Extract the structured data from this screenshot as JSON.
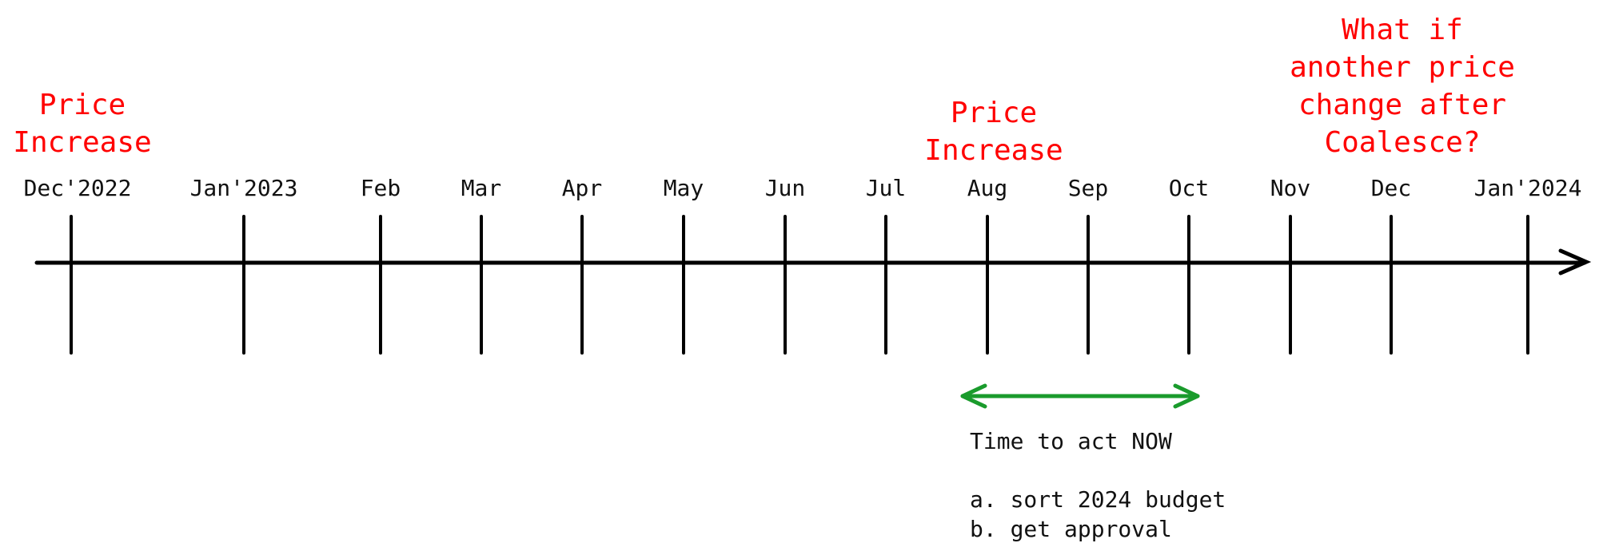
{
  "timeline": {
    "months": [
      "Dec'2022",
      "Jan'2023",
      "Feb",
      "Mar",
      "Apr",
      "May",
      "Jun",
      "Jul",
      "Aug",
      "Sep",
      "Oct",
      "Nov",
      "Dec",
      "Jan'2024"
    ],
    "axis_color": "#000000",
    "direction": "right-arrow"
  },
  "annotations": {
    "price_increase_1": {
      "anchor_month": "Dec'2022",
      "lines": [
        "Price",
        "Increase"
      ],
      "color": "#ff0000"
    },
    "price_increase_2": {
      "anchor_month": "Aug",
      "lines": [
        "Price",
        "Increase"
      ],
      "color": "#ff0000"
    },
    "what_if": {
      "anchor_month": "Dec",
      "lines": [
        "What if",
        "another price",
        "change after",
        "Coalesce?"
      ],
      "color": "#ff0000"
    },
    "action_window": {
      "from_month": "Aug",
      "to_month": "Oct",
      "color": "#1a9b2c",
      "title": "Time to act NOW",
      "items": [
        "a. sort 2024 budget",
        "b. get approval"
      ]
    }
  }
}
